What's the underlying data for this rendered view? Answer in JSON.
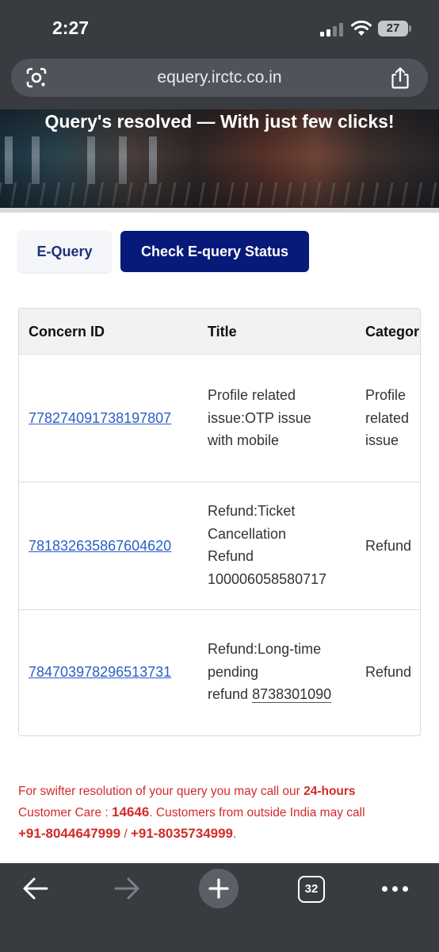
{
  "status_bar": {
    "time": "2:27",
    "battery": "27"
  },
  "browser": {
    "url": "equery.irctc.co.in",
    "tab_count": "32"
  },
  "hero": {
    "title": "Query's resolved — With just few clicks!"
  },
  "tabs": [
    {
      "label": "E-Query",
      "active": false
    },
    {
      "label": "Check E-query Status",
      "active": true
    }
  ],
  "table": {
    "headers": [
      "Concern ID",
      "Title",
      "Category"
    ],
    "header_visible": [
      "Concern ID",
      "Title",
      "Categor"
    ],
    "rows": [
      {
        "concern_id": "778274091738197807",
        "title_lines": [
          "Profile related",
          "issue:OTP issue",
          "with mobile"
        ],
        "category_lines": [
          "Profile",
          "related",
          "issue"
        ]
      },
      {
        "concern_id": "781832635867604620",
        "title_lines": [
          "Refund:Ticket",
          "Cancellation",
          "Refund",
          "100006058580717"
        ],
        "category_lines": [
          "Refund"
        ]
      },
      {
        "concern_id": "784703978296513731",
        "title_lines": [
          "Refund:Long-time",
          "pending",
          "refund"
        ],
        "title_phone": "8738301090",
        "category_lines": [
          "Refund"
        ]
      }
    ]
  },
  "note": {
    "part1": "For swifter resolution of your query you may call our ",
    "hours": "24-hours",
    "part2": "Customer Care : ",
    "care_number": "14646",
    "part3": ". Customers from outside India may call",
    "phone1": "+91-8044647999",
    "separator": " / ",
    "phone2": "+91-8035734999",
    "end": "."
  },
  "colors": {
    "chrome": "#383b40",
    "accent_navy": "#071a7a",
    "link_blue": "#2a5fc4",
    "note_red": "#d42a2a"
  }
}
